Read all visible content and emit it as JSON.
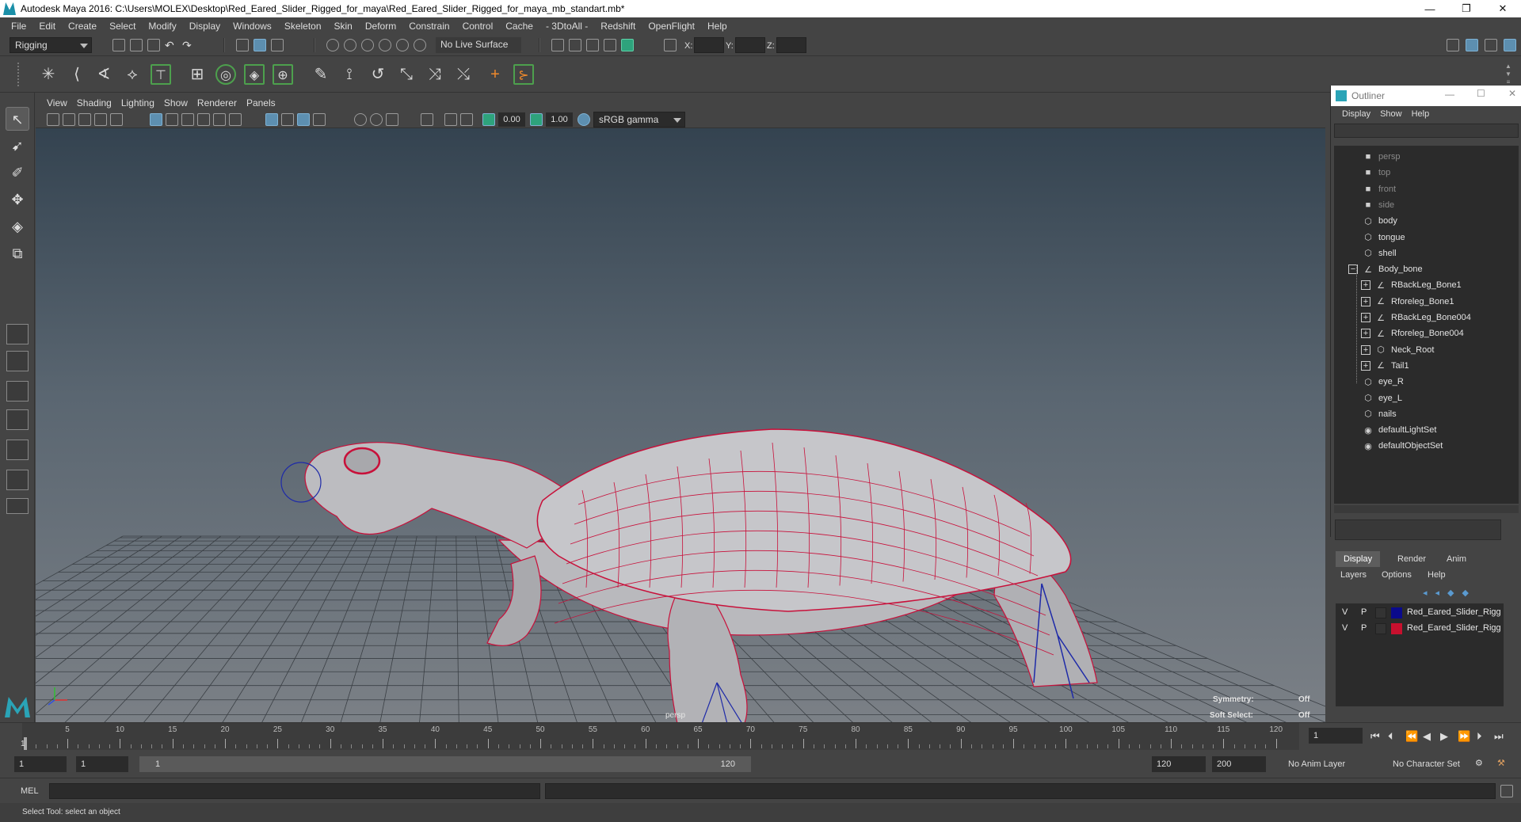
{
  "window": {
    "title": "Autodesk Maya 2016: C:\\Users\\MOLEX\\Desktop\\Red_Eared_Slider_Rigged_for_maya\\Red_Eared_Slider_Rigged_for_maya_mb_standart.mb*",
    "min": "—",
    "max": "❐",
    "close": "✕"
  },
  "menubar": [
    "File",
    "Edit",
    "Create",
    "Select",
    "Modify",
    "Display",
    "Windows",
    "Skeleton",
    "Skin",
    "Deform",
    "Constrain",
    "Control",
    "Cache",
    "- 3DtoAll -",
    "Redshift",
    "OpenFlight",
    "Help"
  ],
  "statusline": {
    "mode": "Rigging",
    "live_surface": "No Live Surface",
    "x_label": "X:",
    "y_label": "Y:",
    "z_label": "Z:"
  },
  "viewport": {
    "menu": [
      "View",
      "Shading",
      "Lighting",
      "Show",
      "Renderer",
      "Panels"
    ],
    "exposure": "0.00",
    "gamma": "1.00",
    "color_space": "sRGB gamma",
    "camera": "persp",
    "symmetry_label": "Symmetry:",
    "symmetry_value": "Off",
    "soft_select_label": "Soft Select:",
    "soft_select_value": "Off"
  },
  "outliner": {
    "title": "Outliner",
    "menu": [
      "Display",
      "Show",
      "Help"
    ],
    "items": [
      {
        "label": "persp",
        "depth": 0,
        "dim": true,
        "icon": "camera-icon",
        "exp": ""
      },
      {
        "label": "top",
        "depth": 0,
        "dim": true,
        "icon": "camera-icon",
        "exp": ""
      },
      {
        "label": "front",
        "depth": 0,
        "dim": true,
        "icon": "camera-icon",
        "exp": ""
      },
      {
        "label": "side",
        "depth": 0,
        "dim": true,
        "icon": "camera-icon",
        "exp": ""
      },
      {
        "label": "body",
        "depth": 0,
        "dim": false,
        "icon": "mesh-icon",
        "exp": ""
      },
      {
        "label": "tongue",
        "depth": 0,
        "dim": false,
        "icon": "mesh-icon",
        "exp": ""
      },
      {
        "label": "shell",
        "depth": 0,
        "dim": false,
        "icon": "mesh-icon",
        "exp": ""
      },
      {
        "label": "Body_bone",
        "depth": 0,
        "dim": false,
        "icon": "joint-icon",
        "exp": "−"
      },
      {
        "label": "RBackLeg_Bone1",
        "depth": 1,
        "dim": false,
        "icon": "joint-icon",
        "exp": "+"
      },
      {
        "label": "Rforeleg_Bone1",
        "depth": 1,
        "dim": false,
        "icon": "joint-icon",
        "exp": "+"
      },
      {
        "label": "RBackLeg_Bone004",
        "depth": 1,
        "dim": false,
        "icon": "joint-icon",
        "exp": "+"
      },
      {
        "label": "Rforeleg_Bone004",
        "depth": 1,
        "dim": false,
        "icon": "joint-icon",
        "exp": "+"
      },
      {
        "label": "Neck_Root",
        "depth": 1,
        "dim": false,
        "icon": "mesh-icon",
        "exp": "+"
      },
      {
        "label": "Tail1",
        "depth": 1,
        "dim": false,
        "icon": "joint-icon",
        "exp": "+"
      },
      {
        "label": "eye_R",
        "depth": 0,
        "dim": false,
        "icon": "mesh-icon",
        "exp": ""
      },
      {
        "label": "eye_L",
        "depth": 0,
        "dim": false,
        "icon": "mesh-icon",
        "exp": ""
      },
      {
        "label": "nails",
        "depth": 0,
        "dim": false,
        "icon": "mesh-icon",
        "exp": ""
      },
      {
        "label": "defaultLightSet",
        "depth": 0,
        "dim": false,
        "icon": "set-icon",
        "exp": ""
      },
      {
        "label": "defaultObjectSet",
        "depth": 0,
        "dim": false,
        "icon": "set-icon",
        "exp": ""
      }
    ]
  },
  "layers": {
    "tabs": [
      "Display",
      "Render",
      "Anim"
    ],
    "menu": [
      "Layers",
      "Options",
      "Help"
    ],
    "rows": [
      {
        "v": "V",
        "p": "P",
        "color": "#0a0a8c",
        "name": "Red_Eared_Slider_Rigg"
      },
      {
        "v": "V",
        "p": "P",
        "color": "#c8102e",
        "name": "Red_Eared_Slider_Rigg"
      }
    ]
  },
  "timeline": {
    "ticks": [
      5,
      10,
      15,
      20,
      25,
      30,
      35,
      40,
      45,
      50,
      55,
      60,
      65,
      70,
      75,
      80,
      85,
      90,
      95,
      100,
      105,
      110,
      115,
      120
    ],
    "first_frame": "1",
    "current_frame": "1"
  },
  "range": {
    "start": "1",
    "playback_start": "1",
    "slider_start": "1",
    "slider_end": "120",
    "playback_end": "120",
    "end": "200",
    "anim_layer": "No Anim Layer",
    "character_set": "No Character Set"
  },
  "cmd": {
    "label": "MEL"
  },
  "help": {
    "text": "Select Tool: select an object"
  },
  "colors": {
    "wire": "#c8103a",
    "rig": "#1e2aa8",
    "grid": "#3a3f44"
  }
}
